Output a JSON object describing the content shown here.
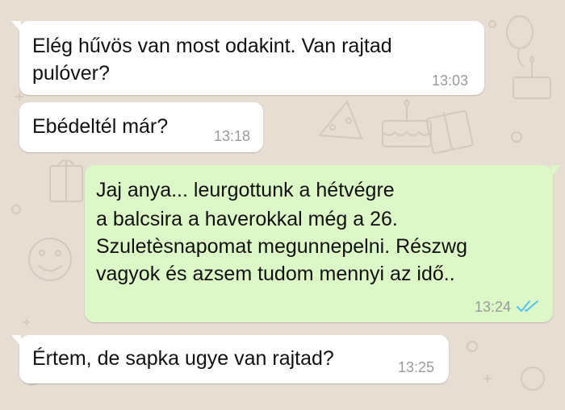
{
  "chat": {
    "background_color": "#e6ddd3",
    "incoming_bubble_color": "#ffffff",
    "outgoing_bubble_color": "#dcf8c6",
    "read_receipt_color": "#4fc3f7",
    "messages": [
      {
        "direction": "incoming",
        "lines": [
          "Elég hűvös van most odakint. Van rajtad",
          "pulóver?"
        ],
        "time": "13:03"
      },
      {
        "direction": "incoming",
        "lines": [
          "Ebédeltél már?"
        ],
        "time": "13:18"
      },
      {
        "direction": "outgoing",
        "lines": [
          "Jaj anya... leurgottunk a hétvégre",
          "a balcsira a haverokkal még a 26.",
          "Szuletèsnapomat megunnepelni. Részwg",
          "vagyok és azsem tudom mennyi az idő.."
        ],
        "time": "13:24",
        "status_icon": "double-check-read-icon"
      },
      {
        "direction": "incoming",
        "lines": [
          "Értem, de sapka ugye van rajtad?"
        ],
        "time": "13:25"
      }
    ]
  }
}
